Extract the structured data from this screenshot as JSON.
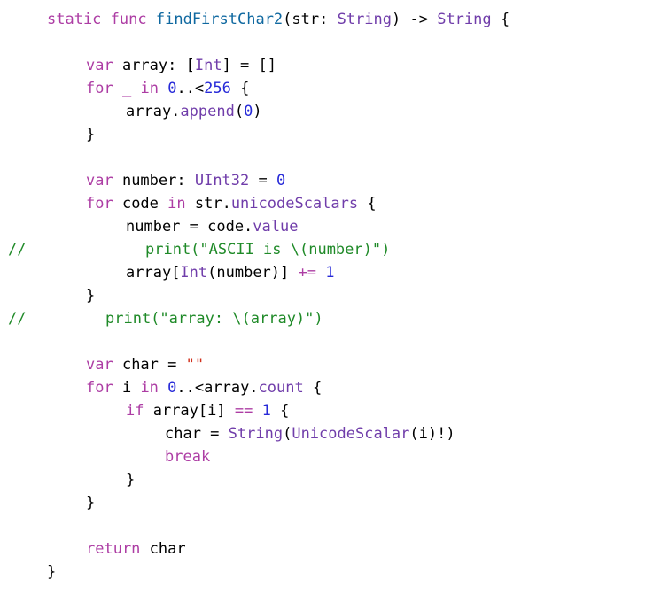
{
  "colors": {
    "keyword": "#ad3da4",
    "type": "#703daa",
    "function_declaration": "#0f68a0",
    "number": "#272ad8",
    "string": "#d12f1b",
    "comment": "#1f8a28",
    "plain": "#000000",
    "background": "#ffffff"
  },
  "code": {
    "lines": [
      [
        {
          "t": "static",
          "k": "keyword"
        },
        {
          "t": " ",
          "k": "plain"
        },
        {
          "t": "func",
          "k": "keyword"
        },
        {
          "t": " ",
          "k": "plain"
        },
        {
          "t": "findFirstChar2",
          "k": "funcdecl"
        },
        {
          "t": "(str: ",
          "k": "plain"
        },
        {
          "t": "String",
          "k": "type"
        },
        {
          "t": ") -> ",
          "k": "plain"
        },
        {
          "t": "String",
          "k": "type"
        },
        {
          "t": " {",
          "k": "plain"
        }
      ],
      [],
      [
        {
          "t": "var",
          "k": "keyword"
        },
        {
          "t": " array: [",
          "k": "plain"
        },
        {
          "t": "Int",
          "k": "type"
        },
        {
          "t": "] = []",
          "k": "plain"
        }
      ],
      [
        {
          "t": "for",
          "k": "keyword"
        },
        {
          "t": " ",
          "k": "plain"
        },
        {
          "t": "_",
          "k": "keyword"
        },
        {
          "t": " ",
          "k": "plain"
        },
        {
          "t": "in",
          "k": "keyword"
        },
        {
          "t": " ",
          "k": "plain"
        },
        {
          "t": "0",
          "k": "number"
        },
        {
          "t": "..<",
          "k": "plain"
        },
        {
          "t": "256",
          "k": "number"
        },
        {
          "t": " {",
          "k": "plain"
        }
      ],
      [
        {
          "t": "array.",
          "k": "plain"
        },
        {
          "t": "append",
          "k": "type"
        },
        {
          "t": "(",
          "k": "plain"
        },
        {
          "t": "0",
          "k": "number"
        },
        {
          "t": ")",
          "k": "plain"
        }
      ],
      [
        {
          "t": "}",
          "k": "plain"
        }
      ],
      [],
      [
        {
          "t": "var",
          "k": "keyword"
        },
        {
          "t": " number: ",
          "k": "plain"
        },
        {
          "t": "UInt32",
          "k": "type"
        },
        {
          "t": " = ",
          "k": "plain"
        },
        {
          "t": "0",
          "k": "number"
        }
      ],
      [
        {
          "t": "for",
          "k": "keyword"
        },
        {
          "t": " code ",
          "k": "plain"
        },
        {
          "t": "in",
          "k": "keyword"
        },
        {
          "t": " str.",
          "k": "plain"
        },
        {
          "t": "unicodeScalars",
          "k": "type"
        },
        {
          "t": " {",
          "k": "plain"
        }
      ],
      [
        {
          "t": "number = code.",
          "k": "plain"
        },
        {
          "t": "value",
          "k": "type"
        }
      ],
      [
        {
          "t": "//",
          "k": "comment"
        }
      ],
      [
        {
          "t": "array[",
          "k": "plain"
        },
        {
          "t": "Int",
          "k": "type"
        },
        {
          "t": "(number)] ",
          "k": "plain"
        },
        {
          "t": "+=",
          "k": "keyword"
        },
        {
          "t": " ",
          "k": "plain"
        },
        {
          "t": "1",
          "k": "number"
        }
      ],
      [
        {
          "t": "}",
          "k": "plain"
        }
      ],
      [
        {
          "t": "//",
          "k": "comment"
        }
      ],
      [],
      [
        {
          "t": "var",
          "k": "keyword"
        },
        {
          "t": " char = ",
          "k": "plain"
        },
        {
          "t": "\"\"",
          "k": "string"
        }
      ],
      [
        {
          "t": "for",
          "k": "keyword"
        },
        {
          "t": " i ",
          "k": "plain"
        },
        {
          "t": "in",
          "k": "keyword"
        },
        {
          "t": " ",
          "k": "plain"
        },
        {
          "t": "0",
          "k": "number"
        },
        {
          "t": "..<array.",
          "k": "plain"
        },
        {
          "t": "count",
          "k": "type"
        },
        {
          "t": " {",
          "k": "plain"
        }
      ],
      [
        {
          "t": "if",
          "k": "keyword"
        },
        {
          "t": " array[i] ",
          "k": "plain"
        },
        {
          "t": "==",
          "k": "keyword"
        },
        {
          "t": " ",
          "k": "plain"
        },
        {
          "t": "1",
          "k": "number"
        },
        {
          "t": " {",
          "k": "plain"
        }
      ],
      [
        {
          "t": "char = ",
          "k": "plain"
        },
        {
          "t": "String",
          "k": "type"
        },
        {
          "t": "(",
          "k": "plain"
        },
        {
          "t": "UnicodeScalar",
          "k": "type"
        },
        {
          "t": "(i)!)",
          "k": "plain"
        }
      ],
      [
        {
          "t": "break",
          "k": "keyword"
        }
      ],
      [
        {
          "t": "}",
          "k": "plain"
        }
      ],
      [
        {
          "t": "}",
          "k": "plain"
        }
      ],
      [],
      [
        {
          "t": "return",
          "k": "keyword"
        },
        {
          "t": " char",
          "k": "plain"
        }
      ],
      [
        {
          "t": "}",
          "k": "plain"
        }
      ]
    ],
    "comment_bodies": {
      "10": "print(\"ASCII is \\(number)\")",
      "13": "print(\"array: \\(array)\")"
    }
  }
}
